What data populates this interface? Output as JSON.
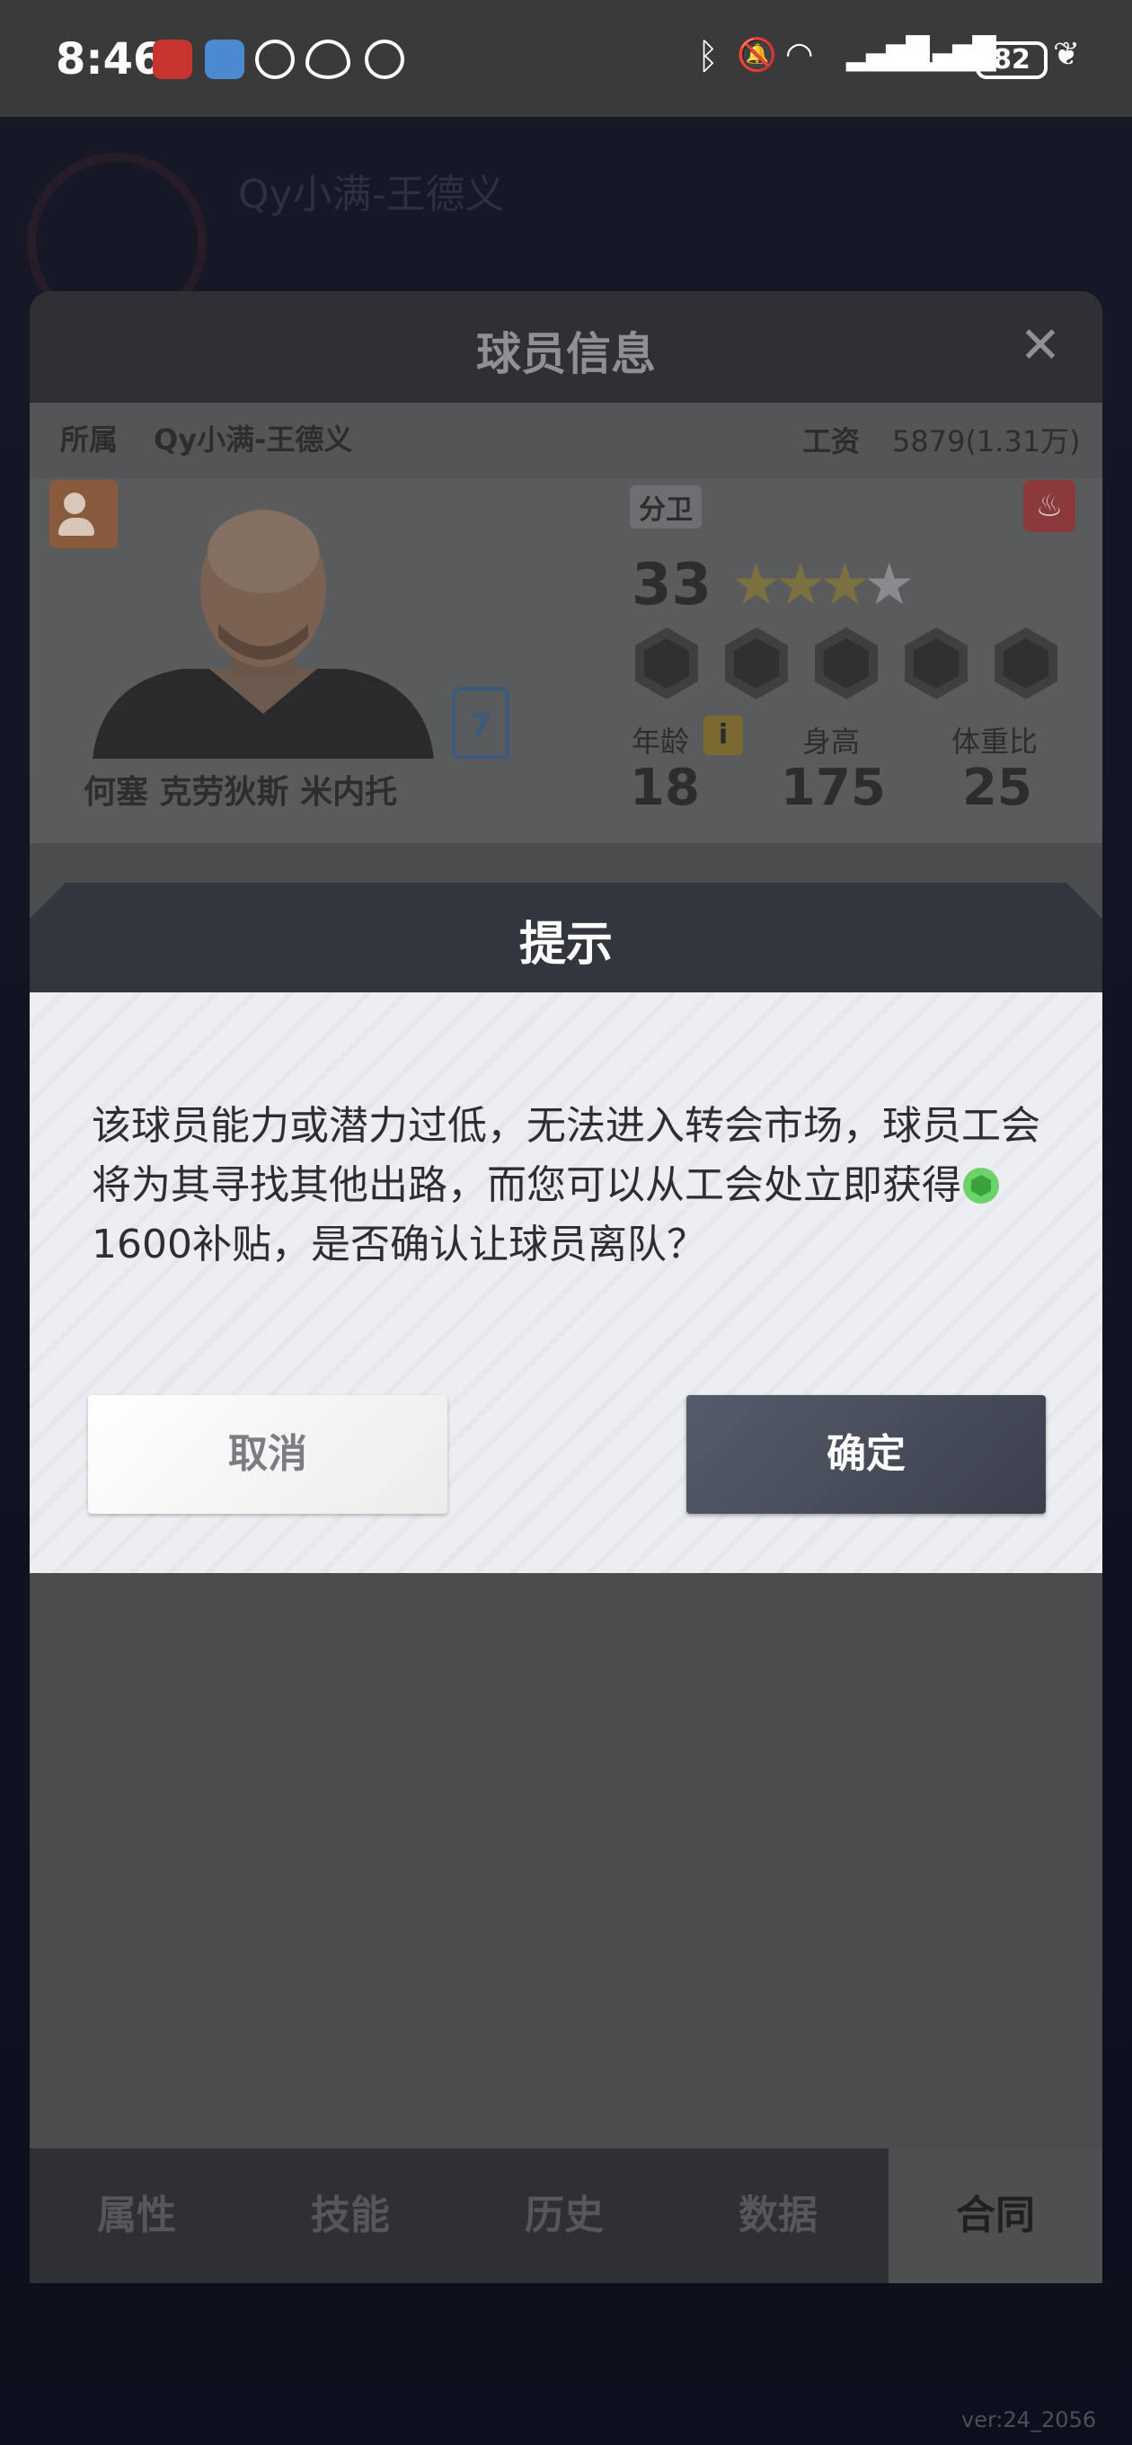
{
  "status_bar": {
    "time": "8:46",
    "battery": "82",
    "notif_icons": [
      "app-badge-icon",
      "app-cloud-icon",
      "app-tiktok-icon",
      "eye-icon",
      "alarm-icon"
    ],
    "system_icons": [
      "bluetooth-icon",
      "mute-icon",
      "wifi-icon",
      "signal-icon",
      "signal-icon",
      "battery-icon",
      "leaf-icon"
    ]
  },
  "background": {
    "team_name": "Qy小满-王德义"
  },
  "panel": {
    "title": "球员信息",
    "close": "✕",
    "affiliation_label": "所属",
    "affiliation_value": "Qy小满-王德义",
    "salary_label": "工资",
    "salary_value": "5879(1.31万)",
    "position": "分卫",
    "overall": "33",
    "stars": 3.5,
    "jersey_number": "7",
    "player_name": "何塞 克劳狄斯 米内托",
    "age_label": "年龄",
    "age_info": "i",
    "age": "18",
    "height_label": "身高",
    "height": "175",
    "weight_label": "体重比",
    "weight": "25"
  },
  "tabs": [
    "属性",
    "技能",
    "历史",
    "数据",
    "合同"
  ],
  "active_tab": "合同",
  "dialog": {
    "title": "提示",
    "message_part1": "该球员能力或潜力过低，无法进入转会市场，球员工会将为其寻找其他出路，而您可以从工会处立即获得",
    "message_part2": "1600补贴，是否确认让球员离队？",
    "cancel_label": "取消",
    "confirm_label": "确定"
  },
  "version": "ver:24_2056",
  "colors": {
    "dialog_header": "#33363d",
    "confirm_button": "#4a4f5d",
    "coin": "#6cd26a"
  }
}
